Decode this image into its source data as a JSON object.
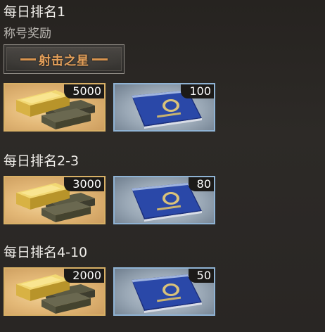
{
  "sections": [
    {
      "title": "每日排名1",
      "subtitle": "称号奖励",
      "badge_text": "射击之星",
      "rewards": [
        {
          "icon": "gold-bars-icon",
          "quantity": "5000"
        },
        {
          "icon": "passport-book-icon",
          "quantity": "100"
        }
      ]
    },
    {
      "title": "每日排名2-3",
      "rewards": [
        {
          "icon": "gold-bars-icon",
          "quantity": "3000"
        },
        {
          "icon": "passport-book-icon",
          "quantity": "80"
        }
      ]
    },
    {
      "title": "每日排名4-10",
      "rewards": [
        {
          "icon": "gold-bars-icon",
          "quantity": "2000"
        },
        {
          "icon": "passport-book-icon",
          "quantity": "50"
        }
      ]
    }
  ],
  "colors": {
    "gold_border": "#d8b066",
    "book_border": "#8fb3d4",
    "badge_text": "#e4a05a"
  }
}
